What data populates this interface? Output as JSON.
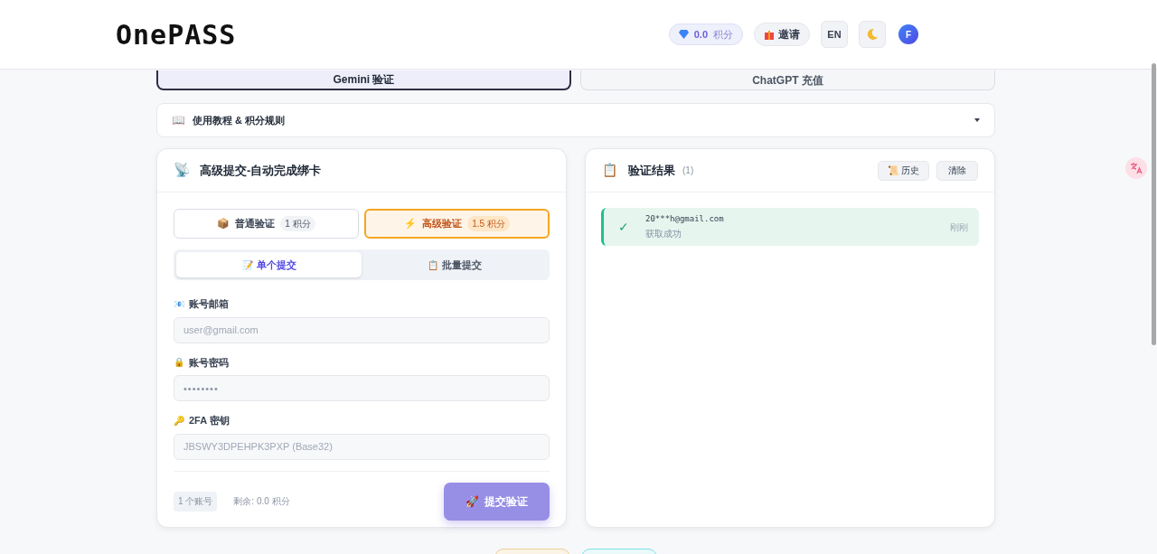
{
  "header": {
    "logo": "OnePASS",
    "points": "0.0",
    "points_unit": "积分",
    "invite": "邀请",
    "language": "EN",
    "avatar": "F"
  },
  "mode_tabs": [
    {
      "label": "Gemini 验证",
      "selected": true
    },
    {
      "label": "ChatGPT 充值",
      "selected": false
    }
  ],
  "guide": {
    "icon": "📖",
    "title": "使用教程 & 积分规则",
    "expanded": false
  },
  "submit_panel": {
    "icon": "📡",
    "title": "高级提交-自动完成绑卡",
    "verify_types": [
      {
        "icon": "📦",
        "label": "普通验证",
        "cost": "1 积分",
        "selected": false
      },
      {
        "icon": "⚡",
        "label": "高级验证",
        "cost": "1.5 积分",
        "selected": true
      }
    ],
    "submit_tabs": [
      {
        "icon": "📝",
        "label": "单个提交",
        "selected": true
      },
      {
        "icon": "📋",
        "label": "批量提交",
        "selected": false
      }
    ],
    "fields": [
      {
        "icon": "📧",
        "label": "账号邮箱",
        "placeholder": "user@gmail.com",
        "kind": "text"
      },
      {
        "icon": "🔒",
        "label": "账号密码",
        "placeholder": "••••••••",
        "kind": "password"
      },
      {
        "icon": "🔑",
        "label": "2FA 密钥",
        "placeholder": "JBSWY3DPEHPK3PXP (Base32)",
        "kind": "text"
      }
    ],
    "account_count": "1 个账号",
    "remaining": "剩余: 0.0 积分",
    "submit": {
      "icon": "🚀",
      "label": "提交验证",
      "disabled": true
    }
  },
  "result_panel": {
    "icon": "📋",
    "title": "验证结果",
    "count": "(1)",
    "history": {
      "icon": "📜",
      "label": "历史"
    },
    "clear": "清除",
    "results": [
      {
        "kind": "success",
        "mark": "✓",
        "email": "20***h@gmail.com",
        "message": "获取成功",
        "time": "刚刚"
      }
    ]
  }
}
